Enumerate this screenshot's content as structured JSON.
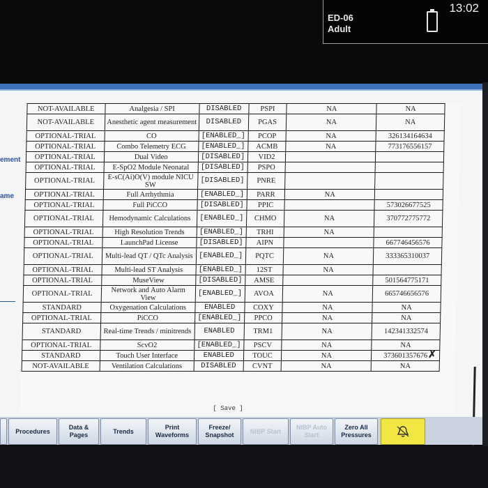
{
  "status": {
    "location": "ED-06",
    "patient_type": "Adult",
    "time": "13:02"
  },
  "sidebar": {
    "label1": "ement",
    "label2": "ame"
  },
  "table": {
    "rows": [
      [
        "NOT-AVAILABLE",
        "Analgesia / SPI",
        "DISABLED",
        "PSPI",
        "NA",
        "NA"
      ],
      [
        "NOT-AVAILABLE",
        "Anesthetic agent measurement",
        "DISABLED",
        "PGAS",
        "NA",
        "NA"
      ],
      [
        "OPTIONAL-TRIAL",
        "CO",
        "[ENABLED_]",
        "PCOP",
        "NA",
        "326134164634"
      ],
      [
        "OPTIONAL-TRIAL",
        "Combo Telemetry ECG",
        "[ENABLED_]",
        "ACMB",
        "NA",
        "773176556157"
      ],
      [
        "OPTIONAL-TRIAL",
        "Dual Video",
        "[DISABLED]",
        "VID2",
        "",
        ""
      ],
      [
        "OPTIONAL-TRIAL",
        "E-SpO2 Module Neonatal",
        "[DISABLED]",
        "PSPO",
        "",
        ""
      ],
      [
        "OPTIONAL-TRIAL",
        "E-sC(Ai)O(V) module NICU SW",
        "[DISABLED]",
        "PNRE",
        "",
        ""
      ],
      [
        "OPTIONAL-TRIAL",
        "Full Arrhythmia",
        "[ENABLED_]",
        "PARR",
        "NA",
        ""
      ],
      [
        "OPTIONAL-TRIAL",
        "Full PiCCO",
        "[DISABLED]",
        "PPIC",
        "",
        "573026677525"
      ],
      [
        "OPTIONAL-TRIAL",
        "Hemodynamic Calculations",
        "[ENABLED_]",
        "CHMO",
        "NA",
        "370772775772"
      ],
      [
        "OPTIONAL-TRIAL",
        "High Resolution Trends",
        "[ENABLED_]",
        "TRHI",
        "NA",
        ""
      ],
      [
        "OPTIONAL-TRIAL",
        "LaunchPad License",
        "[DISABLED]",
        "AIPN",
        "",
        "667746456576"
      ],
      [
        "OPTIONAL-TRIAL",
        "Multi-lead QT / QTc Analysis",
        "[ENABLED_]",
        "PQTC",
        "NA",
        "333365310037"
      ],
      [
        "OPTIONAL-TRIAL",
        "Multi-lead ST Analysis",
        "[ENABLED_]",
        "12ST",
        "NA",
        ""
      ],
      [
        "OPTIONAL-TRIAL",
        "MuseView",
        "[DISABLED]",
        "AMSE",
        "",
        "501564775171"
      ],
      [
        "OPTIONAL-TRIAL",
        "Network and Auto Alarm View",
        "[ENABLED_]",
        "AVOA",
        "NA",
        "665746656576"
      ],
      [
        "STANDARD",
        "Oxygenation Calculations",
        "ENABLED",
        "COXY",
        "NA",
        "NA"
      ],
      [
        "OPTIONAL-TRIAL",
        "PiCCO",
        "[ENABLED_]",
        "PPCO",
        "NA",
        "NA"
      ],
      [
        "STANDARD",
        "Real-time Trends / minitrends",
        "ENABLED",
        "TRM1",
        "NA",
        "142341332574"
      ],
      [
        "OPTIONAL-TRIAL",
        "ScvO2",
        "[ENABLED_]",
        "PSCV",
        "NA",
        "NA"
      ],
      [
        "STANDARD",
        "Touch User Interface",
        "ENABLED",
        "TOUC",
        "NA",
        "373601357676"
      ],
      [
        "NOT-AVAILABLE",
        "Ventilation Calculations",
        "DISABLED",
        "CVNT",
        "NA",
        "NA"
      ]
    ]
  },
  "save_label": "[ Save ]",
  "toolbar": {
    "procedures": "Procedures",
    "data_pages": "Data & Pages",
    "trends": "Trends",
    "print_waveforms": "Print Waveforms",
    "freeze_snapshot": "Freeze/ Snapshot",
    "nibp_start": "NIBP Start",
    "nibp_auto_start": "NIBP Auto Start",
    "zero_all": "Zero All Pressures"
  },
  "colors": {
    "accent": "#3f72b8",
    "alarm": "#f2e742"
  },
  "icons": {
    "alarm": "alarm-bell-icon",
    "battery": "battery-icon"
  }
}
